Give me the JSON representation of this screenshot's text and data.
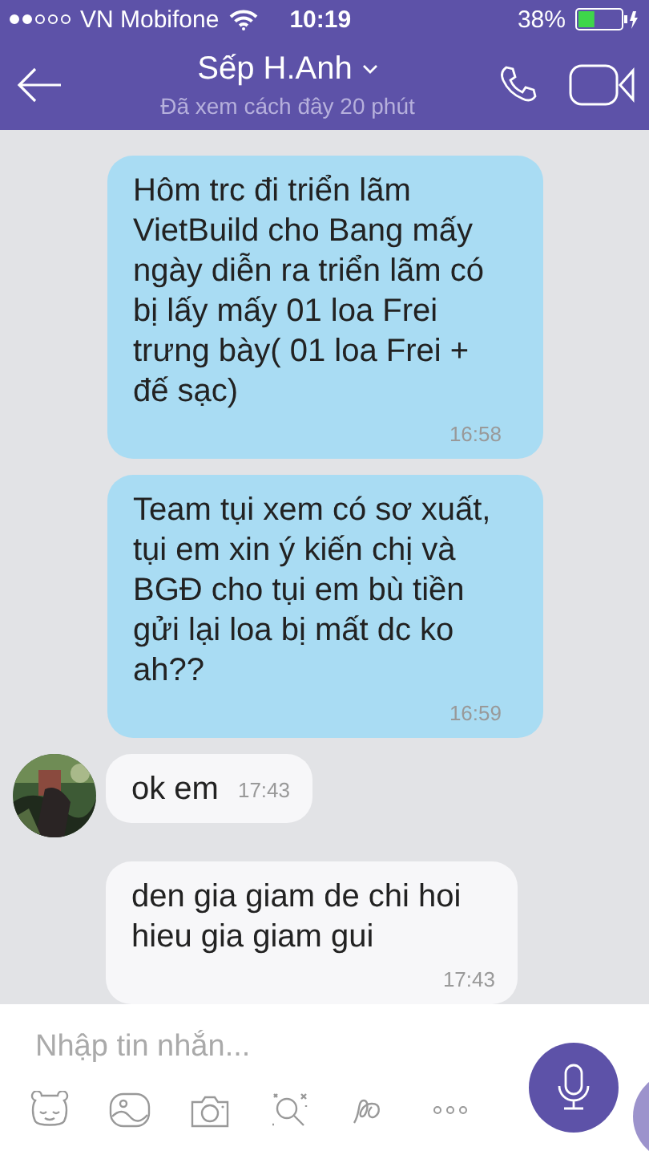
{
  "status_bar": {
    "carrier": "VN Mobifone",
    "time": "10:19",
    "battery": "38%",
    "level": 0.38
  },
  "header": {
    "title": "Sếp H.Anh",
    "subtitle": "Đã xem cách đây 20 phút"
  },
  "messages": [
    {
      "kind": "outgoing",
      "text": "Hôm trc đi triển lãm VietBuild cho Bang mấy ngày diễn ra triển lãm có bị lấy mấy 01 loa Frei trưng bày( 01 loa Frei + đế sạc)",
      "time": "16:58"
    },
    {
      "kind": "outgoing",
      "text": "Team tụi xem có sơ xuất, tụi em xin ý kiến chị và BGĐ cho tụi em bù tiền gửi lại loa bị mất dc ko ah??",
      "time": "16:59"
    },
    {
      "kind": "incoming",
      "avatar": true,
      "text": "ok em",
      "time": "17:43"
    },
    {
      "kind": "incoming",
      "avatar": false,
      "text": "den gia giam de chi hoi hieu gia giam gui",
      "time": "17:43"
    }
  ],
  "composer": {
    "placeholder": "Nhập tin nhắn..."
  }
}
